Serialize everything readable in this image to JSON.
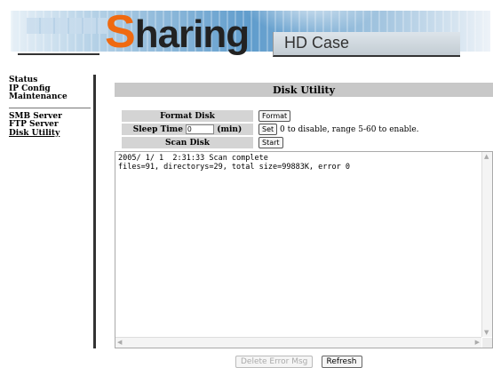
{
  "brand": {
    "first_letter": "S",
    "rest": "haring",
    "subtitle": "HD Case"
  },
  "nav": {
    "items_top": [
      "Status",
      "IP Config",
      "Maintenance"
    ],
    "items_bottom": [
      "SMB Server",
      "FTP Server",
      "Disk Utility"
    ]
  },
  "page_title": "Disk Utility",
  "format": {
    "label": "Format Disk",
    "button": "Format"
  },
  "sleep": {
    "label": "Sleep Time",
    "value": "0",
    "unit": "(min)",
    "button": "Set",
    "hint": "0 to disable, range 5-60 to enable."
  },
  "scan": {
    "label": "Scan Disk",
    "button": "Start"
  },
  "log": {
    "lines": [
      "2005/ 1/ 1  2:31:33 Scan complete",
      "files=91, directorys=29, total size=99883K, error 0"
    ]
  },
  "buttons": {
    "delete": "Delete Error Msg",
    "refresh": "Refresh"
  },
  "icons": {
    "scroll_up": "chevron-up-icon",
    "scroll_down": "chevron-down-icon",
    "scroll_left": "chevron-left-icon",
    "scroll_right": "chevron-right-icon"
  },
  "colors": {
    "accent": "#ef6a11",
    "header_bg": "#c8c8c8",
    "label_bg": "#d4d4d4"
  }
}
